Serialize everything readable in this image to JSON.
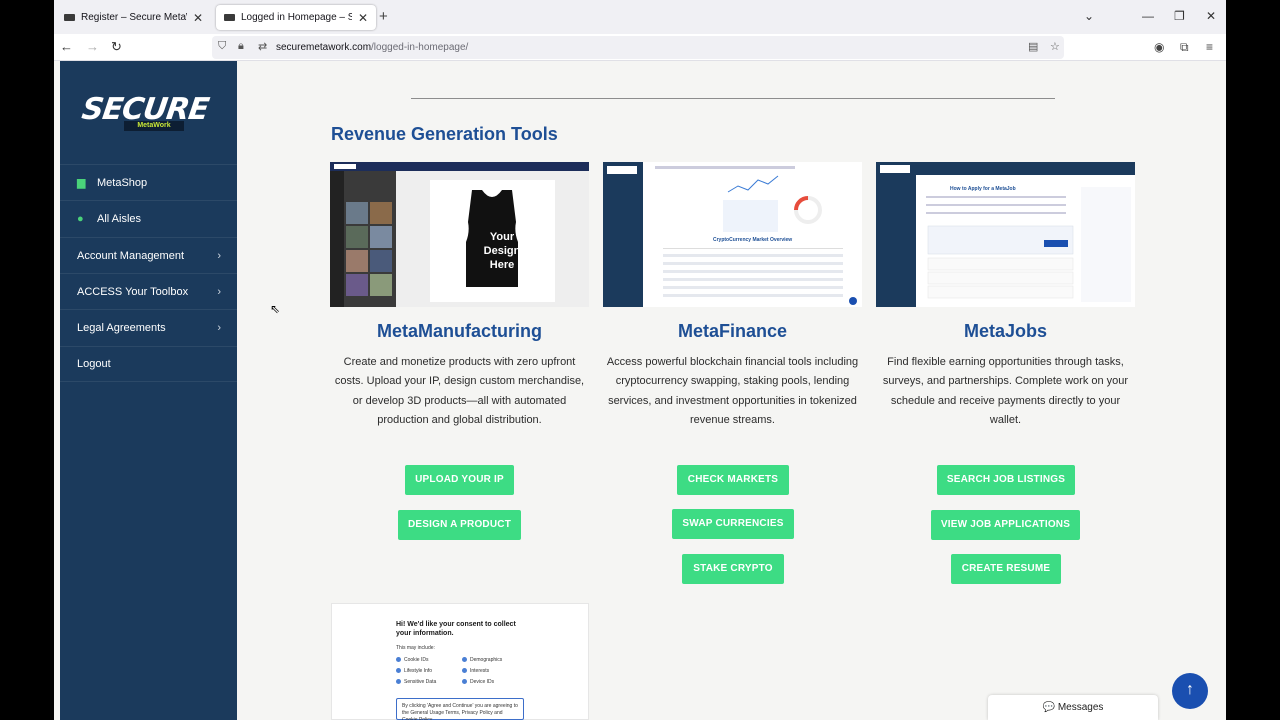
{
  "browser": {
    "tabs": [
      {
        "title": "Register – Secure MetaWork",
        "close": "✕"
      },
      {
        "title": "Logged in Homepage – Secure",
        "close": "✕"
      }
    ],
    "new_tab": "+",
    "url_host": "securemetawork.com",
    "url_path": "/logged-in-homepage/"
  },
  "sidebar": {
    "logo_word": "SECURE",
    "logo_sub": "MetaWork",
    "items": [
      {
        "label": "MetaShop",
        "icon": "shop-icon",
        "icon_glyph": "▆"
      },
      {
        "label": "All Aisles",
        "icon": "pin-icon",
        "icon_glyph": "●"
      },
      {
        "label": "Account Management",
        "chevron": "›"
      },
      {
        "label": "ACCESS Your Toolbox",
        "chevron": "›"
      },
      {
        "label": "Legal Agreements",
        "chevron": "›"
      },
      {
        "label": "Logout"
      }
    ]
  },
  "main": {
    "section_title": "Revenue Generation Tools",
    "columns": [
      {
        "title": "MetaManufacturing",
        "description": "Create and monetize products with zero upfront costs. Upload your IP, design custom merchandise, or develop 3D products—all with automated production and global distribution.",
        "thumb_text": "Your Design Here",
        "buttons": [
          "UPLOAD YOUR IP",
          "DESIGN A PRODUCT"
        ]
      },
      {
        "title": "MetaFinance",
        "description": "Access powerful blockchain financial tools including cryptocurrency swapping, staking pools, lending services, and investment opportunities in tokenized revenue streams.",
        "thumb_heading": "CryptoCurrency Market Overview",
        "buttons": [
          "CHECK MARKETS",
          "SWAP CURRENCIES",
          "STAKE CRYPTO"
        ]
      },
      {
        "title": "MetaJobs",
        "description": "Find flexible earning opportunities through tasks, surveys, and partnerships. Complete work on your schedule and receive payments directly to your wallet.",
        "thumb_heading": "How to Apply for a MetaJob",
        "buttons": [
          "SEARCH JOB LISTINGS",
          "VIEW JOB APPLICATIONS",
          "CREATE RESUME"
        ]
      }
    ],
    "consent": {
      "heading": "Hi! We'd like your consent to collect your information.",
      "may_include": "This may include:",
      "items_left": [
        "Cookie IDs",
        "Lifestyle Info",
        "Sensitive Data"
      ],
      "items_right": [
        "Demographics",
        "Interests",
        "Device IDs"
      ],
      "agree_text": "By clicking 'Agree and Continue' you are agreeing to the General Usage Terms, Privacy Policy and Cookie Policy"
    }
  },
  "widgets": {
    "messages_label": "Messages",
    "messages_icon": "💬",
    "scroll_top_glyph": "↑"
  },
  "colors": {
    "sidebar_bg": "#1b3a5c",
    "accent_green": "#3ddc84",
    "heading_blue": "#1e4f95"
  }
}
